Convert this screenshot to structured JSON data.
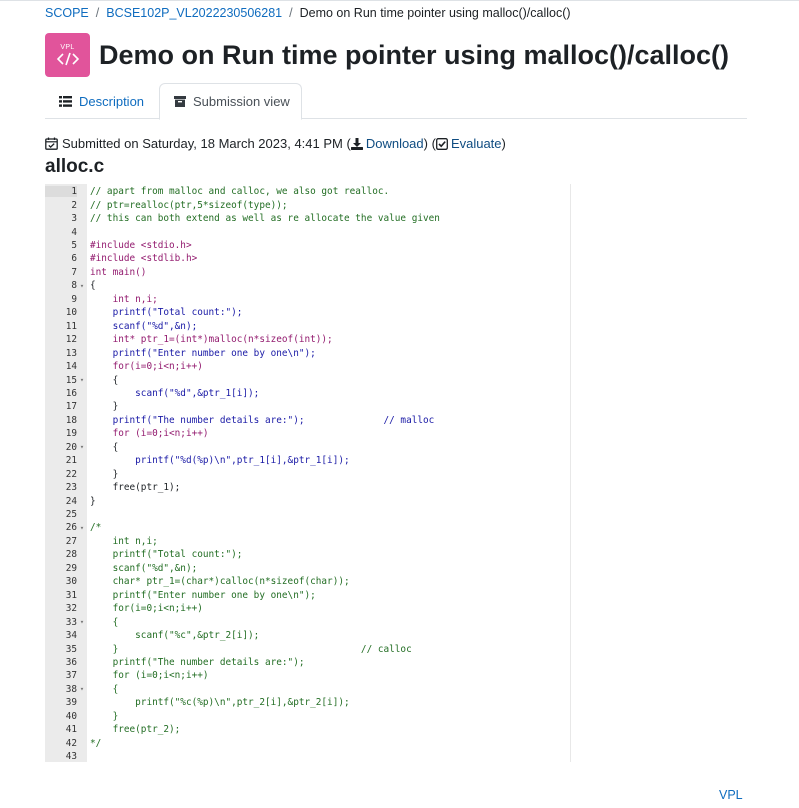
{
  "breadcrumb": {
    "items": [
      "SCOPE",
      "BCSE102P_VL2022230506281"
    ],
    "current": "Demo on Run time pointer using malloc()/calloc()"
  },
  "header": {
    "logo_text": "VPL",
    "logo_color": "#e1549b",
    "title": "Demo on Run time pointer using malloc()/calloc()"
  },
  "tabs": [
    {
      "label": "Description",
      "icon": "list-icon",
      "active": false
    },
    {
      "label": "Submission view",
      "icon": "archive-icon",
      "active": true
    }
  ],
  "submission": {
    "text": "Submitted on Saturday, 18 March 2023, 4:41 PM",
    "download_label": "Download",
    "evaluate_label": "Evaluate"
  },
  "file": {
    "name": "alloc.c",
    "lines": [
      {
        "n": "1",
        "fold": "",
        "type": "comment",
        "text": "// apart from malloc and calloc, we also got realloc."
      },
      {
        "n": "2",
        "fold": "",
        "type": "comment",
        "text": "// ptr=realloc(ptr,5*sizeof(type));"
      },
      {
        "n": "3",
        "fold": "",
        "type": "comment",
        "text": "// this can both extend as well as re allocate the value given"
      },
      {
        "n": "4",
        "fold": "",
        "type": "plain",
        "text": ""
      },
      {
        "n": "5",
        "fold": "",
        "type": "kw",
        "text": "#include <stdio.h>"
      },
      {
        "n": "6",
        "fold": "",
        "type": "kw",
        "text": "#include <stdlib.h>"
      },
      {
        "n": "7",
        "fold": "",
        "type": "kw",
        "text": "int main()"
      },
      {
        "n": "8",
        "fold": "▾",
        "type": "plain",
        "text": "{"
      },
      {
        "n": "9",
        "fold": "",
        "type": "kw",
        "text": "    int n,i;"
      },
      {
        "n": "10",
        "fold": "",
        "type": "str",
        "text": "    printf(\"Total count:\");"
      },
      {
        "n": "11",
        "fold": "",
        "type": "str",
        "text": "    scanf(\"%d\",&n);"
      },
      {
        "n": "12",
        "fold": "",
        "type": "kw",
        "text": "    int* ptr_1=(int*)malloc(n*sizeof(int));"
      },
      {
        "n": "13",
        "fold": "",
        "type": "str",
        "text": "    printf(\"Enter number one by one\\n\");"
      },
      {
        "n": "14",
        "fold": "",
        "type": "kw",
        "text": "    for(i=0;i<n;i++)"
      },
      {
        "n": "15",
        "fold": "▾",
        "type": "plain",
        "text": "    {"
      },
      {
        "n": "16",
        "fold": "",
        "type": "str",
        "text": "        scanf(\"%d\",&ptr_1[i]);"
      },
      {
        "n": "17",
        "fold": "",
        "type": "plain",
        "text": "    }"
      },
      {
        "n": "18",
        "fold": "",
        "type": "str",
        "text": "    printf(\"The number details are:\");              // malloc"
      },
      {
        "n": "19",
        "fold": "",
        "type": "kw",
        "text": "    for (i=0;i<n;i++)"
      },
      {
        "n": "20",
        "fold": "▾",
        "type": "plain",
        "text": "    {"
      },
      {
        "n": "21",
        "fold": "",
        "type": "str",
        "text": "        printf(\"%d(%p)\\n\",ptr_1[i],&ptr_1[i]);"
      },
      {
        "n": "22",
        "fold": "",
        "type": "plain",
        "text": "    }"
      },
      {
        "n": "23",
        "fold": "",
        "type": "plain",
        "text": "    free(ptr_1);"
      },
      {
        "n": "24",
        "fold": "",
        "type": "plain",
        "text": "}"
      },
      {
        "n": "25",
        "fold": "",
        "type": "plain",
        "text": ""
      },
      {
        "n": "26",
        "fold": "▾",
        "type": "comment",
        "text": "/*"
      },
      {
        "n": "27",
        "fold": "",
        "type": "comment",
        "text": "    int n,i;"
      },
      {
        "n": "28",
        "fold": "",
        "type": "comment",
        "text": "    printf(\"Total count:\");"
      },
      {
        "n": "29",
        "fold": "",
        "type": "comment",
        "text": "    scanf(\"%d\",&n);"
      },
      {
        "n": "30",
        "fold": "",
        "type": "comment",
        "text": "    char* ptr_1=(char*)calloc(n*sizeof(char));"
      },
      {
        "n": "31",
        "fold": "",
        "type": "comment",
        "text": "    printf(\"Enter number one by one\\n\");"
      },
      {
        "n": "32",
        "fold": "",
        "type": "comment",
        "text": "    for(i=0;i<n;i++)"
      },
      {
        "n": "33",
        "fold": "▾",
        "type": "comment",
        "text": "    {"
      },
      {
        "n": "34",
        "fold": "",
        "type": "comment",
        "text": "        scanf(\"%c\",&ptr_2[i]);"
      },
      {
        "n": "35",
        "fold": "",
        "type": "comment",
        "text": "    }                                           // calloc"
      },
      {
        "n": "36",
        "fold": "",
        "type": "comment",
        "text": "    printf(\"The number details are:\");"
      },
      {
        "n": "37",
        "fold": "",
        "type": "comment",
        "text": "    for (i=0;i<n;i++)"
      },
      {
        "n": "38",
        "fold": "▾",
        "type": "comment",
        "text": "    {"
      },
      {
        "n": "39",
        "fold": "",
        "type": "comment",
        "text": "        printf(\"%c(%p)\\n\",ptr_2[i],&ptr_2[i]);"
      },
      {
        "n": "40",
        "fold": "",
        "type": "comment",
        "text": "    }"
      },
      {
        "n": "41",
        "fold": "",
        "type": "comment",
        "text": "    free(ptr_2);"
      },
      {
        "n": "42",
        "fold": "",
        "type": "comment",
        "text": "*/"
      },
      {
        "n": "43",
        "fold": "",
        "type": "plain",
        "text": ""
      }
    ]
  },
  "footer": {
    "link_label": "VPL"
  }
}
